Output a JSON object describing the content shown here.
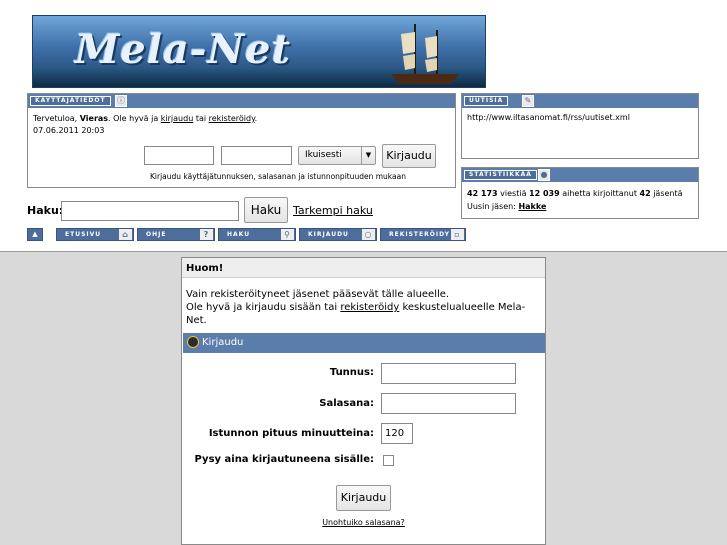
{
  "header": {
    "logo_text": "Mela-Net"
  },
  "user_panel": {
    "title": "KÄYTTÄJÄTIEDOT",
    "welcome_prefix": "Tervetuloa, ",
    "guest_name": "Vieras",
    "welcome_mid": ". Ole hyvä ja ",
    "login_link": "kirjaudu",
    "or_text": " tai ",
    "register_link": "rekisteröidy",
    "period": ".",
    "datetime": "07.06.2011 20:03",
    "duration_selected": "Ikuisesti",
    "login_button": "Kirjaudu",
    "hint": "Kirjaudu käyttäjätunnuksen, salasanan ja istunnonpituuden mukaan"
  },
  "news_panel": {
    "title": "UUTISIA",
    "url": "http://www.iltasanomat.fi/rss/uutiset.xml"
  },
  "stats_panel": {
    "title": "STATISTIIKKAA",
    "line1_a": "42 173",
    "line1_b": " viestiä ",
    "line1_c": "12 039",
    "line1_d": " aihetta kirjoittanut ",
    "line1_e": "42",
    "line1_f": " jäsentä",
    "newest_label": "Uusin jäsen: ",
    "newest_member": "Hakke"
  },
  "search": {
    "label": "Haku:",
    "button": "Haku",
    "advanced_link": "Tarkempi haku"
  },
  "nav": {
    "items": [
      {
        "label": "ETUSIVU"
      },
      {
        "label": "OHJE"
      },
      {
        "label": "HAKU"
      },
      {
        "label": "KIRJAUDU"
      },
      {
        "label": "REKISTERÖIDY"
      }
    ]
  },
  "notice": {
    "title": "Huom!",
    "line1": "Vain rekisteröityneet jäsenet pääsevät tälle alueelle.",
    "line2_a": "Ole hyvä ja kirjaudu sisään tai ",
    "line2_link": "rekisteröidy",
    "line2_b": " keskustelualueelle Mela-Net."
  },
  "login_box": {
    "title": "Kirjaudu",
    "username_label": "Tunnus:",
    "password_label": "Salasana:",
    "session_label": "Istunnon pituus minuutteina:",
    "session_value": "120",
    "remember_label": "Pysy aina kirjautuneena sisälle:",
    "submit": "Kirjaudu",
    "forgot": "Unohtuiko salasana?"
  },
  "colors": {
    "bar_blue": "#5a7dab",
    "background_gray": "#d9d9d9"
  }
}
